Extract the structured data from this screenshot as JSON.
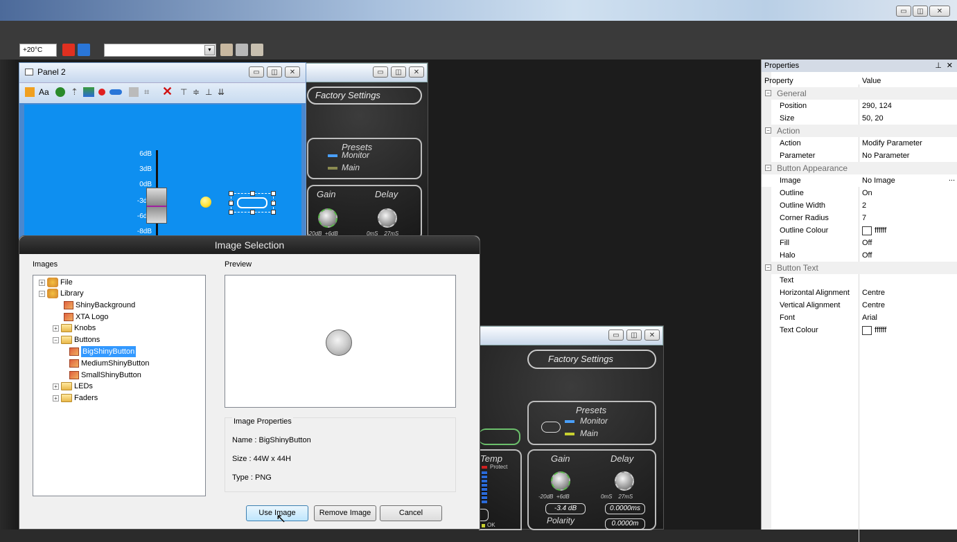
{
  "toolbar": {
    "temp": "+20°C"
  },
  "panel2": {
    "title": "Panel 2",
    "db_labels": [
      "6dB",
      "3dB",
      "0dB",
      "-3dB",
      "-6dB",
      "-8dB"
    ]
  },
  "dsp_back": {
    "factory": "Factory Settings",
    "presets": "Presets",
    "monitor": "Monitor",
    "main": "Main",
    "gain": "Gain",
    "delay": "Delay",
    "gain_range": "-20dB  +6dB",
    "delay_range": "0mS    27mS"
  },
  "dsp_front": {
    "factory": "Factory Settings",
    "presets": "Presets",
    "monitor": "Monitor",
    "main": "Main",
    "gain": "Gain",
    "delay": "Delay",
    "temp": "Temp",
    "protect": "Protect",
    "gain_range": "-20dB  +6dB",
    "delay_range": "0mS    27mS",
    "gain_value": "-3.4 dB",
    "delay_value": "0.0000ms",
    "polarity": "Polarity",
    "meter_value": "0.0000m",
    "ok": "OK"
  },
  "dialog": {
    "title": "Image Selection",
    "images_label": "Images",
    "preview_label": "Preview",
    "tree": [
      {
        "label": "File",
        "indent": 0,
        "exp": "+",
        "icon": "lib"
      },
      {
        "label": "Library",
        "indent": 0,
        "exp": "-",
        "icon": "lib"
      },
      {
        "label": "ShinyBackground",
        "indent": 2,
        "exp": "",
        "icon": "img"
      },
      {
        "label": "XTA Logo",
        "indent": 2,
        "exp": "",
        "icon": "img"
      },
      {
        "label": "Knobs",
        "indent": 1,
        "exp": "+",
        "icon": "fold"
      },
      {
        "label": "Buttons",
        "indent": 1,
        "exp": "-",
        "icon": "fold"
      },
      {
        "label": "BigShinyButton",
        "indent": 2,
        "exp": "",
        "icon": "img",
        "selected": true
      },
      {
        "label": "MediumShinyButton",
        "indent": 2,
        "exp": "",
        "icon": "img"
      },
      {
        "label": "SmallShinyButton",
        "indent": 2,
        "exp": "",
        "icon": "img"
      },
      {
        "label": "LEDs",
        "indent": 1,
        "exp": "+",
        "icon": "fold"
      },
      {
        "label": "Faders",
        "indent": 1,
        "exp": "+",
        "icon": "fold"
      }
    ],
    "image_properties_label": "Image Properties",
    "name": "Name : BigShinyButton",
    "size": "Size : 44W x 44H",
    "type": "Type : PNG",
    "buttons": {
      "use": "Use Image",
      "remove": "Remove Image",
      "cancel": "Cancel"
    }
  },
  "properties": {
    "title": "Properties",
    "col_property": "Property",
    "col_value": "Value",
    "rows": [
      {
        "cat": true,
        "name": "General"
      },
      {
        "name": "Position",
        "value": "290, 124"
      },
      {
        "name": "Size",
        "value": "50, 20"
      },
      {
        "cat": true,
        "name": "Action"
      },
      {
        "name": "Action",
        "value": "Modify Parameter"
      },
      {
        "name": "Parameter",
        "value": "No Parameter"
      },
      {
        "cat": true,
        "name": "Button Appearance"
      },
      {
        "name": "Image",
        "value": "No Image",
        "ellipsis": "..."
      },
      {
        "name": "Outline",
        "value": "On"
      },
      {
        "name": "Outline Width",
        "value": "2"
      },
      {
        "name": "Corner Radius",
        "value": "7"
      },
      {
        "name": "Outline Colour",
        "value": "ffffff",
        "swatch": true
      },
      {
        "name": "Fill",
        "value": "Off"
      },
      {
        "name": "Halo",
        "value": "Off"
      },
      {
        "cat": true,
        "name": "Button Text"
      },
      {
        "name": "Text",
        "value": ""
      },
      {
        "name": "Horizontal Alignment",
        "value": "Centre"
      },
      {
        "name": "Vertical Alignment",
        "value": "Centre"
      },
      {
        "name": "Font",
        "value": "Arial"
      },
      {
        "name": "Text Colour",
        "value": "ffffff",
        "swatch": true
      }
    ]
  },
  "colors": {
    "selection": "#3399ff",
    "panel_blue": "#0e8ff0",
    "led_yellow": "#ffe033"
  }
}
